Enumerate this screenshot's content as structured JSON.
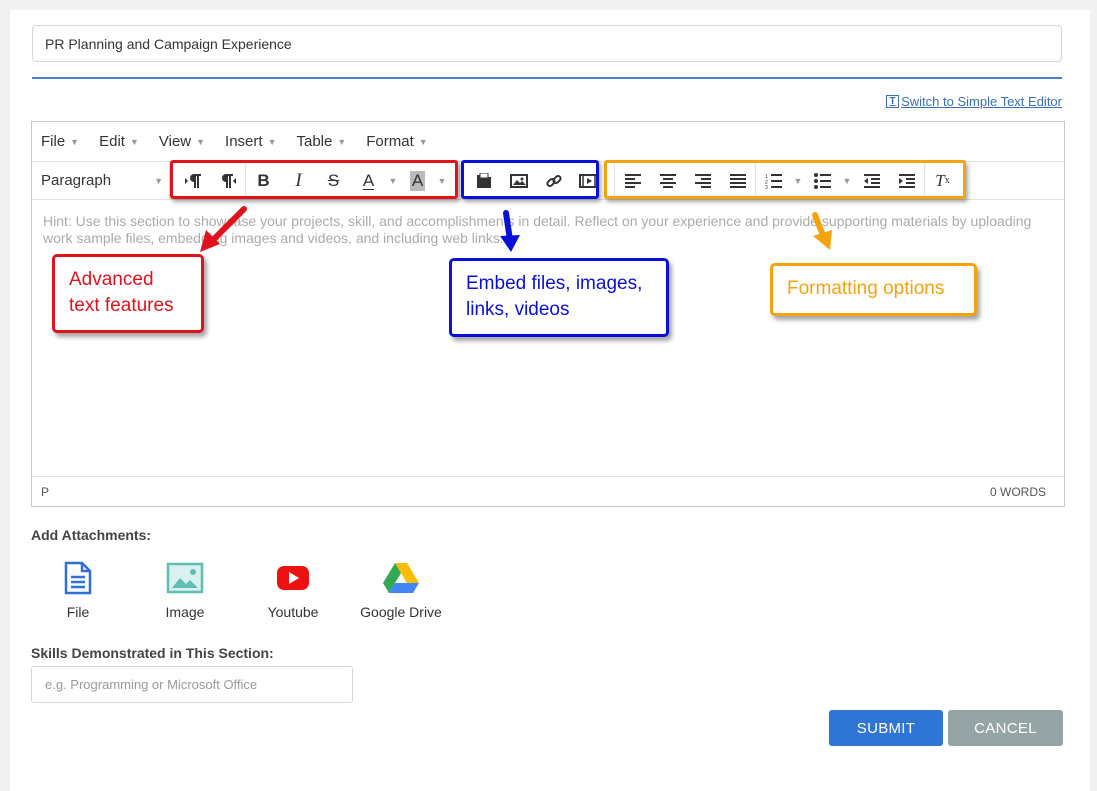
{
  "title_field": {
    "value": "PR Planning and Campaign Experience"
  },
  "switch_link": {
    "icon_char": "T",
    "label": "Switch to Simple Text Editor"
  },
  "editor": {
    "menubar": [
      {
        "label": "File"
      },
      {
        "label": "Edit"
      },
      {
        "label": "View"
      },
      {
        "label": "Insert"
      },
      {
        "label": "Table"
      },
      {
        "label": "Format"
      }
    ],
    "paragraph_select": "Paragraph",
    "hint": "Hint: Use this section to showcase your projects, skill, and accomplishments in detail. Reflect on your experience and provide supporting materials by uploading work sample files, embedding images and videos, and including web links.",
    "status_path": "P",
    "word_count": "0 WORDS"
  },
  "annotations": {
    "advanced": {
      "text_line1": "Advanced",
      "text_line2": "text features",
      "color": "#e0131c"
    },
    "embed": {
      "text_line1": "Embed files, images,",
      "text_line2": "links, videos",
      "color": "#0a10d8"
    },
    "formatting": {
      "text": "Formatting options",
      "color": "#f5a30d"
    }
  },
  "attachments": {
    "label": "Add Attachments:",
    "items": [
      {
        "label": "File",
        "icon": "file-icon"
      },
      {
        "label": "Image",
        "icon": "image-icon"
      },
      {
        "label": "Youtube",
        "icon": "youtube-icon"
      },
      {
        "label": "Google Drive",
        "icon": "google-drive-icon"
      }
    ]
  },
  "skills": {
    "label": "Skills Demonstrated in This Section:",
    "placeholder": "e.g. Programming or Microsoft Office"
  },
  "buttons": {
    "submit": "SUBMIT",
    "cancel": "CANCEL"
  },
  "colors": {
    "accent": "#2f75d6",
    "cancel": "#95a5a6",
    "rule": "#4a7fd4"
  }
}
